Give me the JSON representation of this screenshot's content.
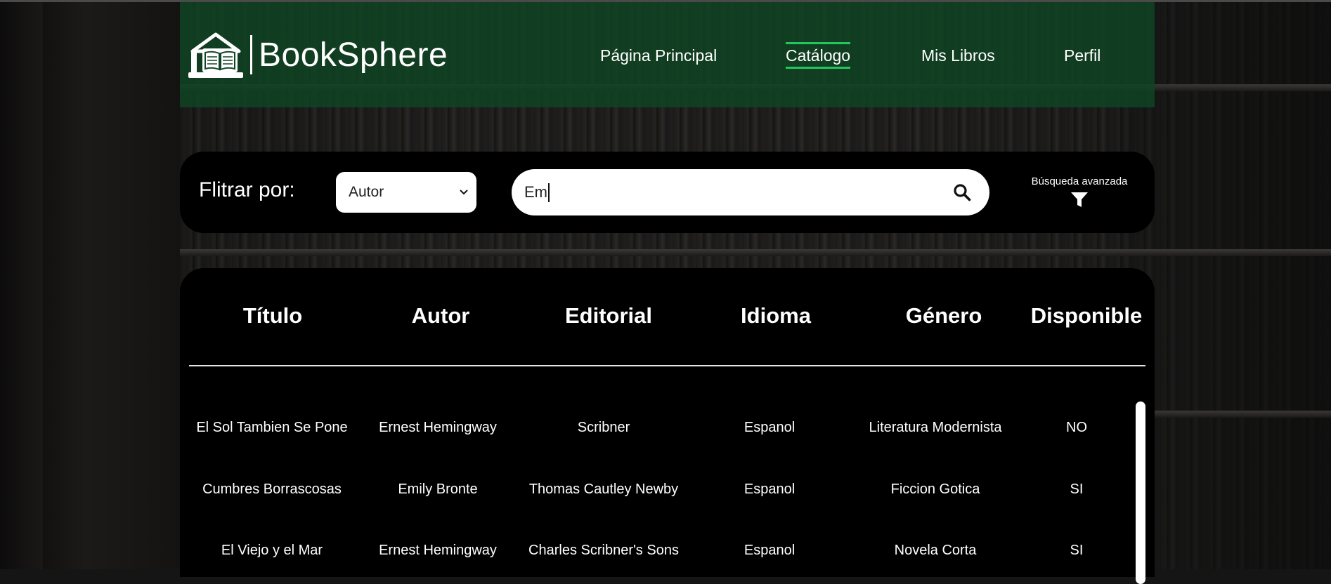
{
  "app": {
    "name": "BookSphere"
  },
  "nav": {
    "items": [
      {
        "label": "Página Principal",
        "active": false
      },
      {
        "label": "Catálogo",
        "active": true
      },
      {
        "label": "Mis Libros",
        "active": false
      },
      {
        "label": "Perfil",
        "active": false
      }
    ]
  },
  "filter": {
    "label": "Flitrar por:",
    "selected": "Autor",
    "search_value": "Em",
    "advanced_label": "Búsqueda avanzada"
  },
  "table": {
    "headers": [
      "Título",
      "Autor",
      "Editorial",
      "Idioma",
      "Género",
      "Disponible"
    ],
    "rows": [
      [
        "El Sol Tambien Se Pone",
        "Ernest Hemingway",
        "Scribner",
        "Espanol",
        "Literatura Modernista",
        "NO"
      ],
      [
        "Cumbres Borrascosas",
        "Emily Bronte",
        "Thomas Cautley Newby",
        "Espanol",
        "Ficcion Gotica",
        "SI"
      ],
      [
        "El Viejo y el Mar",
        "Ernest Hemingway",
        "Charles Scribner's Sons",
        "Espanol",
        "Novela Corta",
        "SI"
      ]
    ]
  },
  "icons": {
    "logo": "library-book-icon",
    "search": "search-icon",
    "advanced": "funnel-icon",
    "select": "chevron-down-icon"
  },
  "colors": {
    "header_bg": "#0f4623",
    "accent": "#22c55e",
    "panel_bg": "#000000"
  }
}
